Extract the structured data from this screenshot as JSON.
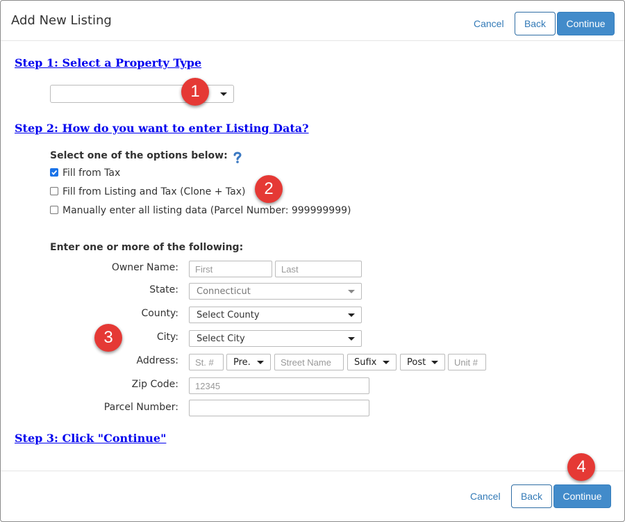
{
  "header": {
    "title": "Add New Listing",
    "cancel": "Cancel",
    "back": "Back",
    "continue": "Continue"
  },
  "step1": {
    "heading": "Step 1: Select a Property Type",
    "property_type_value": ""
  },
  "step2": {
    "heading": "Step 2: How do you want to enter Listing Data?",
    "options_label": "Select one of the options below:",
    "help_icon": "question-mark-icon",
    "options": [
      {
        "label": "Fill from Tax",
        "checked": true
      },
      {
        "label": "Fill from Listing and Tax (Clone + Tax)",
        "checked": false
      },
      {
        "label": "Manually enter all listing data (Parcel Number: 999999999)",
        "checked": false
      }
    ],
    "search_label": "Enter one or more of the following:",
    "owner_label": "Owner Name:",
    "first_placeholder": "First",
    "last_placeholder": "Last",
    "state_label": "State:",
    "state_value": "Connecticut",
    "county_label": "County:",
    "county_value": "Select County",
    "city_label": "City:",
    "city_value": "Select City",
    "address_label": "Address:",
    "street_no_placeholder": "St. #",
    "prefix": "Pre.",
    "street_name_placeholder": "Street Name",
    "suffix": "Sufix",
    "post": "Post",
    "unit_placeholder": "Unit #",
    "zip_label": "Zip Code:",
    "zip_placeholder": "12345",
    "parcel_label": "Parcel Number:",
    "parcel_value": ""
  },
  "step3": {
    "heading": "Step 3: Click \"Continue\""
  },
  "footer": {
    "cancel": "Cancel",
    "back": "Back",
    "continue": "Continue"
  },
  "annotations": [
    "1",
    "2",
    "3",
    "4"
  ],
  "colors": {
    "primary_button": "#428bca",
    "link": "#337ab7",
    "step_heading": "#0000ee",
    "badge": "#e53935"
  }
}
